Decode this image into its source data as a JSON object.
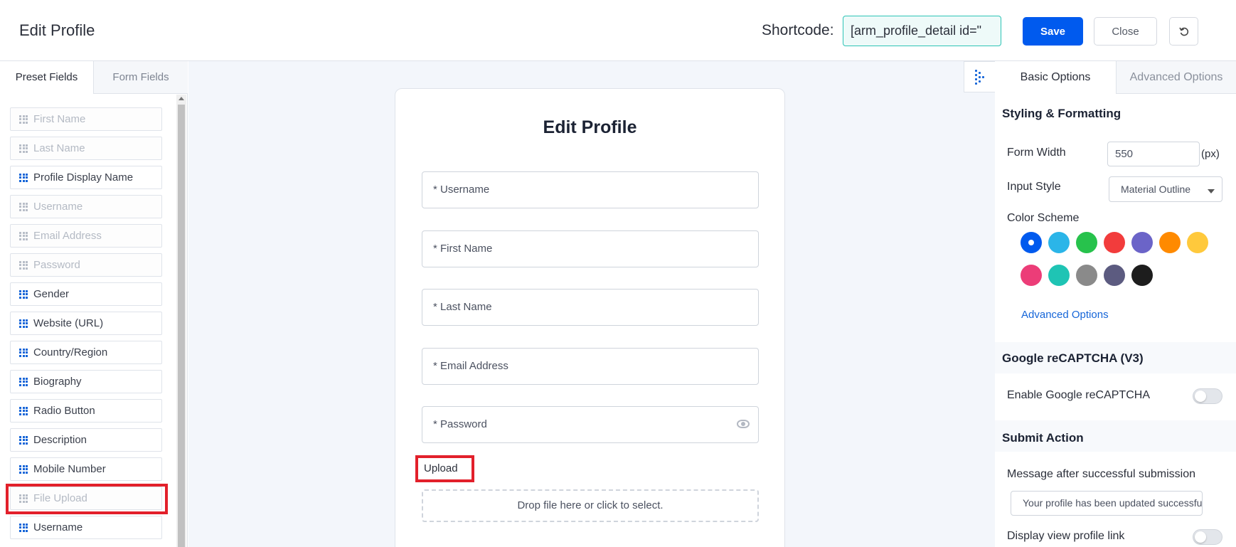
{
  "header": {
    "title": "Edit Profile",
    "shortcode_label": "Shortcode:",
    "shortcode_value": "[arm_profile_detail id=\"",
    "save_label": "Save",
    "close_label": "Close",
    "reset_icon": "reset-icon"
  },
  "left_panel": {
    "tabs": [
      {
        "label": "Preset Fields",
        "active": true
      },
      {
        "label": "Form Fields",
        "active": false
      }
    ],
    "fields": [
      {
        "label": "First Name",
        "disabled": true
      },
      {
        "label": "Last Name",
        "disabled": true
      },
      {
        "label": "Profile Display Name",
        "disabled": false
      },
      {
        "label": "Username",
        "disabled": true
      },
      {
        "label": "Email Address",
        "disabled": true
      },
      {
        "label": "Password",
        "disabled": true
      },
      {
        "label": "Gender",
        "disabled": false
      },
      {
        "label": "Website (URL)",
        "disabled": false
      },
      {
        "label": "Country/Region",
        "disabled": false
      },
      {
        "label": "Biography",
        "disabled": false
      },
      {
        "label": "Radio Button",
        "disabled": false
      },
      {
        "label": "Description",
        "disabled": false
      },
      {
        "label": "Mobile Number",
        "disabled": false
      },
      {
        "label": "File Upload",
        "disabled": true,
        "highlighted": true
      },
      {
        "label": "Username",
        "disabled": false
      }
    ]
  },
  "form": {
    "title": "Edit Profile",
    "fields": [
      {
        "placeholder": "* Username"
      },
      {
        "placeholder": "* First Name"
      },
      {
        "placeholder": "* Last Name"
      },
      {
        "placeholder": "* Email Address"
      },
      {
        "placeholder": "* Password",
        "icon": "eye-icon"
      }
    ],
    "upload_label": "Upload",
    "dropzone_text": "Drop file here or click to select."
  },
  "right_panel": {
    "tabs": [
      {
        "label": "Basic Options",
        "active": true
      },
      {
        "label": "Advanced Options",
        "active": false
      }
    ],
    "styling": {
      "heading": "Styling & Formatting",
      "form_width_label": "Form Width",
      "form_width_value": "550",
      "form_width_unit": "(px)",
      "input_style_label": "Input Style",
      "input_style_value": "Material Outline",
      "color_scheme_label": "Color Scheme",
      "colors": [
        "#005aee",
        "#2bb5e8",
        "#27c24c",
        "#f23c3c",
        "#6b64c8",
        "#ff8a00",
        "#ffc93c",
        "#ec3d78",
        "#1fc4b4",
        "#8a8a8a",
        "#5c5b80",
        "#1d1d1d"
      ],
      "selected_color": "#005aee",
      "advanced_link": "Advanced Options"
    },
    "recaptcha": {
      "heading": "Google reCAPTCHA (V3)",
      "enable_label": "Enable Google reCAPTCHA"
    },
    "submit": {
      "heading": "Submit Action",
      "message_label": "Message after successful submission",
      "message_value": "Your profile has been updated successfully.",
      "view_link_label": "Display view profile link"
    }
  }
}
